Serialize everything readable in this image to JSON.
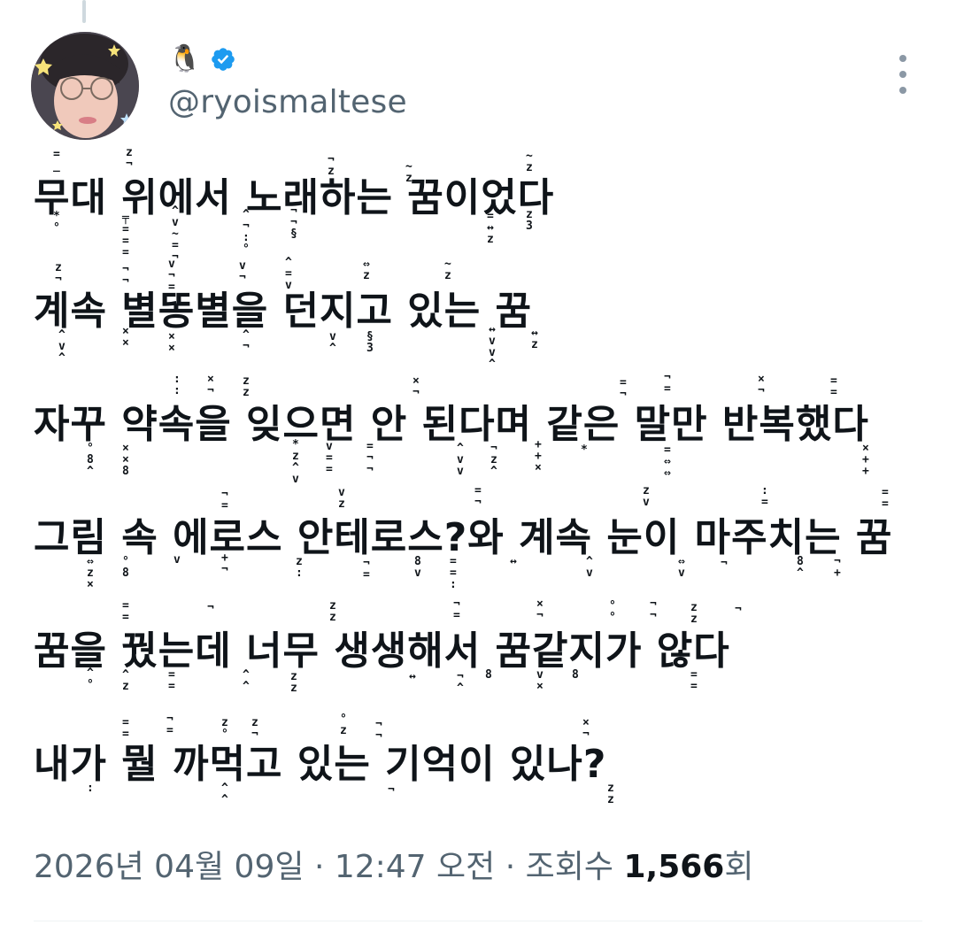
{
  "author": {
    "display_name": "🐧",
    "handle": "@ryoismaltese",
    "verified": true,
    "avatar_icon": "profile-photo"
  },
  "icons": {
    "verified": "verified-badge-icon",
    "more": "more-vertical-icon"
  },
  "tweet": {
    "lines": [
      "무대 위에서 노래하는 꿈이었다",
      "계속 별똥별을 던지고 있는 꿈",
      "자꾸 약속을 잊으면 안 된다며 같은 말만 반복했다",
      "그림 속 에로스 안테로스?와 계속 눈이 마주치는 꿈",
      "꿈을 꿨는데 너무 생생해서 꿈같지가 않다",
      "내가 뭘 까먹고 있는 기억이 있나?"
    ]
  },
  "meta": {
    "date": "2026년 04월 09일",
    "separator": "·",
    "time": "12:47 오전",
    "views_label": "조회수",
    "views_count": "1,566",
    "views_suffix": "회"
  },
  "colors": {
    "text_primary": "#0f1419",
    "text_secondary": "#536471",
    "verified_blue": "#1d9bf0",
    "divider": "#eff3f4"
  }
}
